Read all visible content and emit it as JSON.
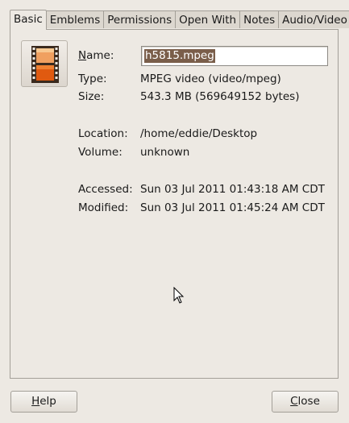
{
  "tabs": [
    "Basic",
    "Emblems",
    "Permissions",
    "Open With",
    "Notes",
    "Audio/Video"
  ],
  "file_icon": "video-file-icon",
  "name_label": "Name:",
  "name_label_accel": "N",
  "name_label_rest": "ame:",
  "name_value": "h5815.mpeg",
  "type_label": "Type:",
  "type_value": "MPEG video (video/mpeg)",
  "size_label": "Size:",
  "size_value": "543.3 MB (569649152 bytes)",
  "location_label": "Location:",
  "location_value": "/home/eddie/Desktop",
  "volume_label": "Volume:",
  "volume_value": "unknown",
  "accessed_label": "Accessed:",
  "accessed_value": "Sun 03 Jul 2011 01:43:18 AM CDT",
  "modified_label": "Modified:",
  "modified_value": "Sun 03 Jul 2011 01:45:24 AM CDT",
  "help_button": {
    "label": "Help",
    "accel": "H",
    "rest": "elp"
  },
  "close_button": {
    "label": "Close",
    "accel": "C",
    "rest": "lose"
  },
  "colors": {
    "selection": "#7a5e4a",
    "film": "#e8651f",
    "background": "#ede9e3"
  }
}
